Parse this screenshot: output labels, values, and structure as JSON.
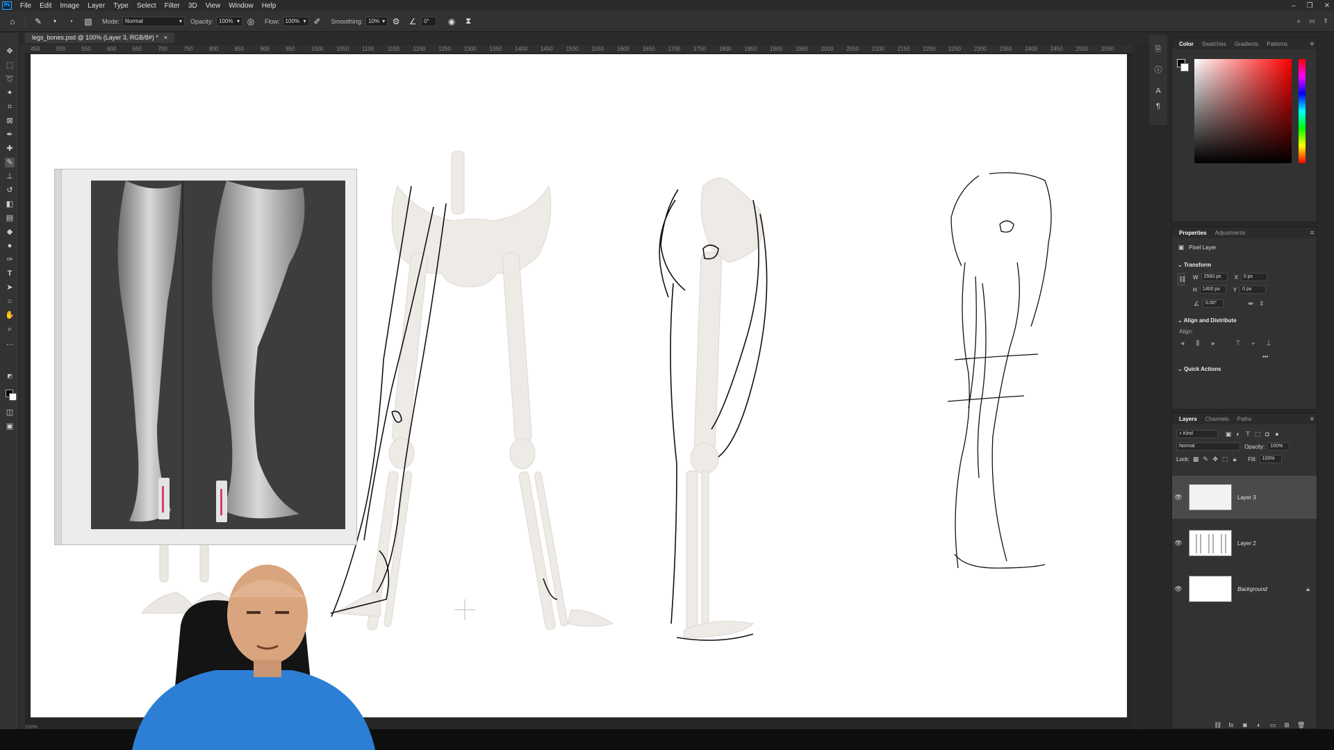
{
  "menubar": {
    "logo": "Ps",
    "items": [
      "File",
      "Edit",
      "Image",
      "Layer",
      "Type",
      "Select",
      "Filter",
      "3D",
      "View",
      "Window",
      "Help"
    ]
  },
  "options": {
    "mode_label": "Mode:",
    "mode_value": "Normal",
    "opacity_label": "Opacity:",
    "opacity_value": "100%",
    "flow_label": "Flow:",
    "flow_value": "100%",
    "smoothing_label": "Smoothing:",
    "smoothing_value": "10%",
    "angle_value": "0°"
  },
  "document": {
    "tab_title": "legs_bones.psd @ 100% (Layer 3, RGB/8#) *",
    "close": "×"
  },
  "ruler": {
    "ticks": [
      "450",
      "500",
      "550",
      "600",
      "650",
      "700",
      "750",
      "800",
      "850",
      "900",
      "950",
      "1000",
      "1050",
      "1100",
      "1150",
      "1200",
      "1250",
      "1300",
      "1350",
      "1400",
      "1450",
      "1500",
      "1550",
      "1600",
      "1650",
      "1700",
      "1750",
      "1800",
      "1850",
      "1900",
      "1950",
      "2000",
      "2050",
      "2100",
      "2150",
      "2200",
      "2250",
      "2300",
      "2350",
      "2400",
      "2450",
      "2500",
      "2550"
    ]
  },
  "color_panel": {
    "tabs": [
      "Color",
      "Swatches",
      "Gradients",
      "Patterns"
    ],
    "fg": "#000000",
    "bg": "#ffffff",
    "hue": "#ff0000"
  },
  "properties": {
    "tabs": [
      "Properties",
      "Adjustments"
    ],
    "kind": "Pixel Layer",
    "transform_title": "Transform",
    "w_label": "W",
    "w_value": "2560 px",
    "h_label": "H",
    "h_value": "1400 px",
    "x_label": "X",
    "x_value": "0 px",
    "y_label": "Y",
    "y_value": "0 px",
    "angle_value": "0.00°",
    "align_title": "Align and Distribute",
    "align_label": "Align:",
    "quick_title": "Quick Actions"
  },
  "layers_panel": {
    "tabs": [
      "Layers",
      "Channels",
      "Paths"
    ],
    "filter": "Kind",
    "blend": "Normal",
    "opacity_label": "Opacity:",
    "opacity_value": "100%",
    "lock_label": "Lock:",
    "fill_label": "Fill:",
    "fill_value": "100%",
    "layers": [
      {
        "name": "Layer 3",
        "selected": true
      },
      {
        "name": "Layer 2",
        "selected": false
      },
      {
        "name": "Background",
        "selected": false
      }
    ]
  },
  "status": {
    "zoom": "100%"
  }
}
